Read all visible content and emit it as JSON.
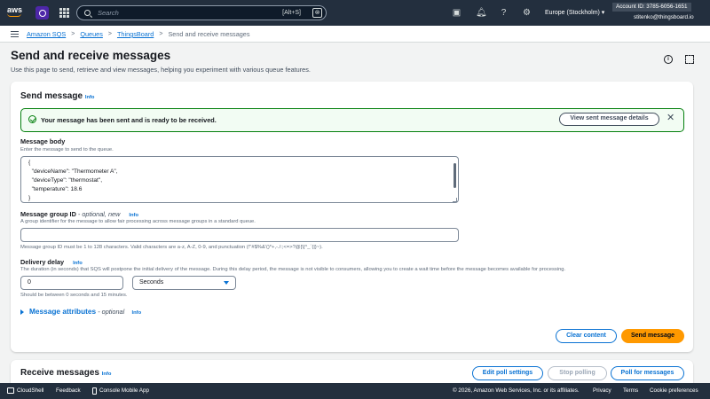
{
  "topnav": {
    "logo": "aws",
    "search_placeholder": "Search",
    "search_shortcut": "[Alt+S]",
    "region": "Europe (Stockholm)",
    "account_id": "Account ID: 3785-6056-1651",
    "user": "stitenko@thingsboard.io",
    "icons": [
      "services-grid-icon",
      "cloudshell-icon",
      "bell-icon",
      "help-icon",
      "gear-icon"
    ]
  },
  "breadcrumb": {
    "items": [
      "Amazon SQS",
      "Queues",
      "ThingsBoard"
    ],
    "current": "Send and receive messages"
  },
  "page": {
    "title": "Send and receive messages",
    "subtitle": "Use this page to send, retrieve and view messages, helping you experiment with various queue features."
  },
  "send_panel": {
    "title": "Send message",
    "info": "Info",
    "flash_message": "Your message has been sent and is ready to be received.",
    "view_details_button": "View sent message details",
    "body_label": "Message body",
    "body_desc": "Enter the message to send to the queue.",
    "body_value": "{\n  \"deviceName\": \"Thermometer A\",\n  \"deviceType\": \"thermostat\",\n  \"temperature\": 18.6\n}",
    "group_label": "Message group ID",
    "group_optional": " - optional, new",
    "group_desc": "A group identifier for the message to allow fair processing across message groups in a standard queue.",
    "group_value": "",
    "group_hint": "Message group ID must be 1 to 128 characters. Valid characters are a-z, A-Z, 0-9, and punctuation (!\"#$%&'()*+,-./:;<=>?@[\\]^_`{|}~).",
    "delay_label": "Delivery delay",
    "delay_desc": "The duration (in seconds) that SQS will postpone the initial delivery of the message. During this delay period, the message is not visible to consumers, allowing you to create a wait time before the message becomes available for processing.",
    "delay_value": "0",
    "delay_unit": "Seconds",
    "delay_hint": "Should be between 0 seconds and 15 minutes.",
    "attributes_label": "Message attributes",
    "attributes_optional": " - optional",
    "clear_button": "Clear content",
    "send_button": "Send message"
  },
  "receive_panel": {
    "title": "Receive messages",
    "info": "Info",
    "edit_poll_button": "Edit poll settings",
    "stop_poll_button": "Stop polling",
    "poll_button": "Poll for messages"
  },
  "footer": {
    "cloudshell": "CloudShell",
    "feedback": "Feedback",
    "console_mobile": "Console Mobile App",
    "copyright": "© 2026, Amazon Web Services, Inc. or its affiliates.",
    "privacy": "Privacy",
    "terms": "Terms",
    "cookies": "Cookie preferences"
  },
  "colors": {
    "nav_bg": "#232f3e",
    "link": "#0972d3",
    "success": "#037f0c",
    "primary_button": "#ff9900"
  }
}
